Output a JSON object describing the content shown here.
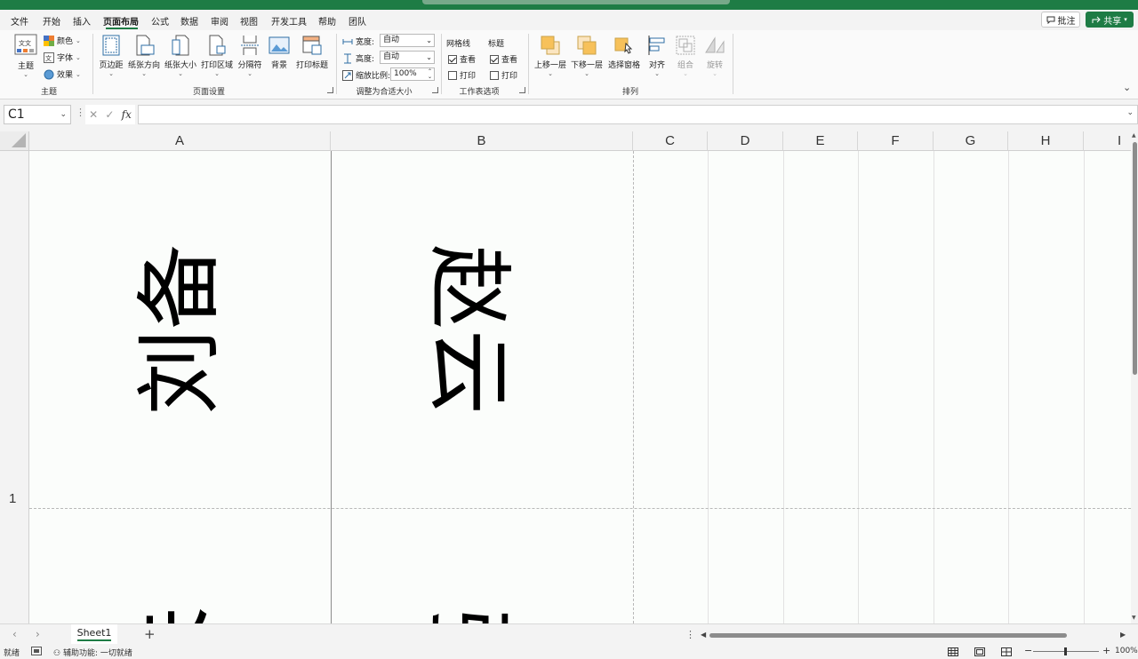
{
  "menu": {
    "items": [
      "文件",
      "开始",
      "插入",
      "页面布局",
      "公式",
      "数据",
      "审阅",
      "视图",
      "开发工具",
      "帮助",
      "团队"
    ],
    "active_index": 3,
    "comment_label": "批注",
    "share_label": "共享"
  },
  "ribbon": {
    "theme_group": {
      "theme_label": "主题",
      "colors_label": "颜色",
      "fonts_label": "字体",
      "effects_label": "效果",
      "group_label": "主题"
    },
    "page_setup": {
      "margins_label": "页边距",
      "orientation_label": "纸张方向",
      "size_label": "纸张大小",
      "print_area_label": "打印区域",
      "breaks_label": "分隔符",
      "background_label": "背景",
      "print_titles_label": "打印标题",
      "group_label": "页面设置"
    },
    "scale_to_fit": {
      "width_label": "宽度:",
      "width_value": "自动",
      "height_label": "高度:",
      "height_value": "自动",
      "scale_label": "缩放比例:",
      "scale_value": "100%",
      "group_label": "调整为合适大小"
    },
    "sheet_options": {
      "gridlines_label": "网格线",
      "headings_label": "标题",
      "view_label": "查看",
      "print_label": "打印",
      "group_label": "工作表选项"
    },
    "arrange": {
      "bring_forward_label": "上移一层",
      "send_backward_label": "下移一层",
      "selection_pane_label": "选择窗格",
      "align_label": "对齐",
      "group_label_btn": "组合",
      "rotate_label": "旋转",
      "group_label": "排列"
    }
  },
  "formula_bar": {
    "name_box": "C1",
    "formula": ""
  },
  "grid": {
    "columns": [
      "A",
      "B",
      "C",
      "D",
      "E",
      "F",
      "G",
      "H",
      "I"
    ],
    "rows": [
      "1"
    ],
    "cells": {
      "A1": "刘备",
      "B1": "赵云",
      "A2_partial": "关",
      "B2_partial": "张"
    }
  },
  "sheets": {
    "tabs": [
      "Sheet1"
    ],
    "active": "Sheet1"
  },
  "status": {
    "ready": "就绪",
    "accessibility": "辅助功能: 一切就绪",
    "zoom": "100%"
  },
  "colors": {
    "accent": "#1e7c45",
    "page_break": "#8c8c8c"
  }
}
